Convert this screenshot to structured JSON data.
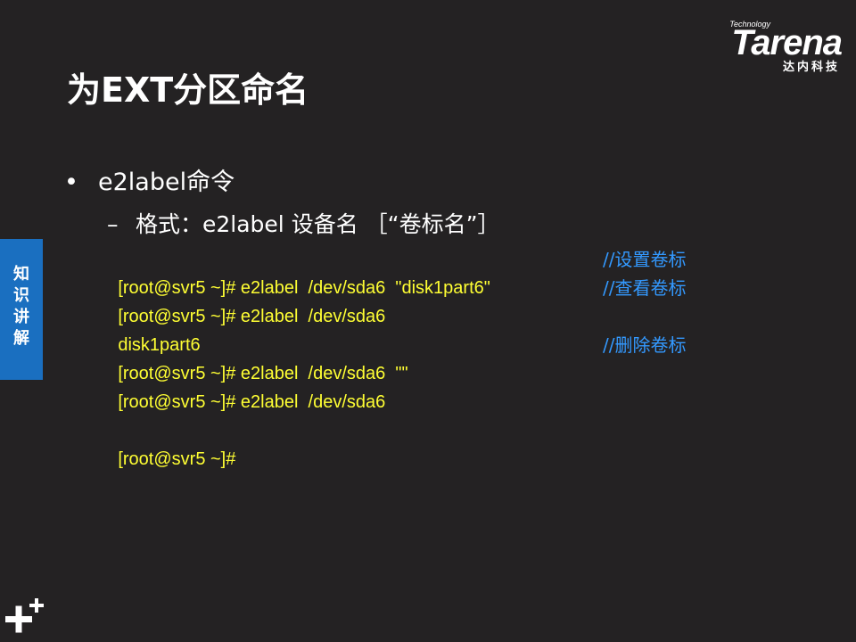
{
  "logo": {
    "sub": "Technology",
    "main": "Tarena",
    "cn": "达内科技"
  },
  "title": "为EXT分区命名",
  "bullet": {
    "marker": "•",
    "text": "e2label命令"
  },
  "sub_item": {
    "marker": "–",
    "text": "格式：e2label  设备名 ［“卷标名”］"
  },
  "code_lines": [
    {
      "cmd": "[root@svr5 ~]# e2label  /dev/sda6  \"disk1part6\"",
      "comment": "//设置卷标"
    },
    {
      "cmd": "[root@svr5 ~]# e2label  /dev/sda6",
      "comment": "//查看卷标"
    },
    {
      "cmd": "disk1part6",
      "comment": ""
    },
    {
      "cmd": "[root@svr5 ~]# e2label  /dev/sda6  \"\"",
      "comment": "//删除卷标"
    },
    {
      "cmd": "[root@svr5 ~]# e2label  /dev/sda6",
      "comment": ""
    },
    {
      "cmd": "",
      "comment": ""
    },
    {
      "cmd": "[root@svr5 ~]#",
      "comment": ""
    }
  ],
  "side_tab": {
    "chars": [
      "知",
      "识",
      "讲",
      "解"
    ]
  },
  "colors": {
    "background": "#242223",
    "command": "#ffff33",
    "comment": "#3399ff",
    "side_tab": "#1a6fc0"
  },
  "icons": {
    "logo": "tarena-logo",
    "corner": "plus-mark-icon"
  }
}
